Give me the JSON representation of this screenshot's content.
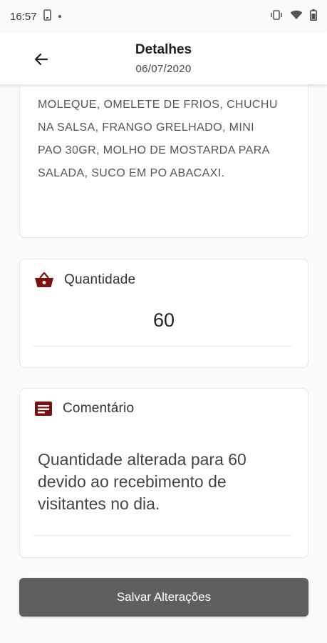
{
  "status_bar": {
    "time": "16:57"
  },
  "header": {
    "title": "Detalhes",
    "date": "06/07/2020"
  },
  "description": {
    "lines": [
      "MOLEQUE, OMELETE DE FRIOS, CHUCHU",
      "NA SALSA, FRANGO GRELHADO, MINI",
      "PAO 30GR, MOLHO DE MOSTARDA PARA",
      "SALADA, SUCO EM PO ABACAXI."
    ]
  },
  "quantity": {
    "label": "Quantidade",
    "value": "60",
    "icon": "basket-icon"
  },
  "comment": {
    "label": "Comentário",
    "icon": "comment-note-icon",
    "lines": [
      "Quantidade alterada para 60",
      "devido ao recebimento de",
      "visitantes no dia."
    ]
  },
  "actions": {
    "save_label": "Salvar Alterações"
  },
  "colors": {
    "accent": "#7a1212",
    "button_bg": "#5f5f5f",
    "card_bg": "#ffffff",
    "page_bg": "#fafafa"
  }
}
